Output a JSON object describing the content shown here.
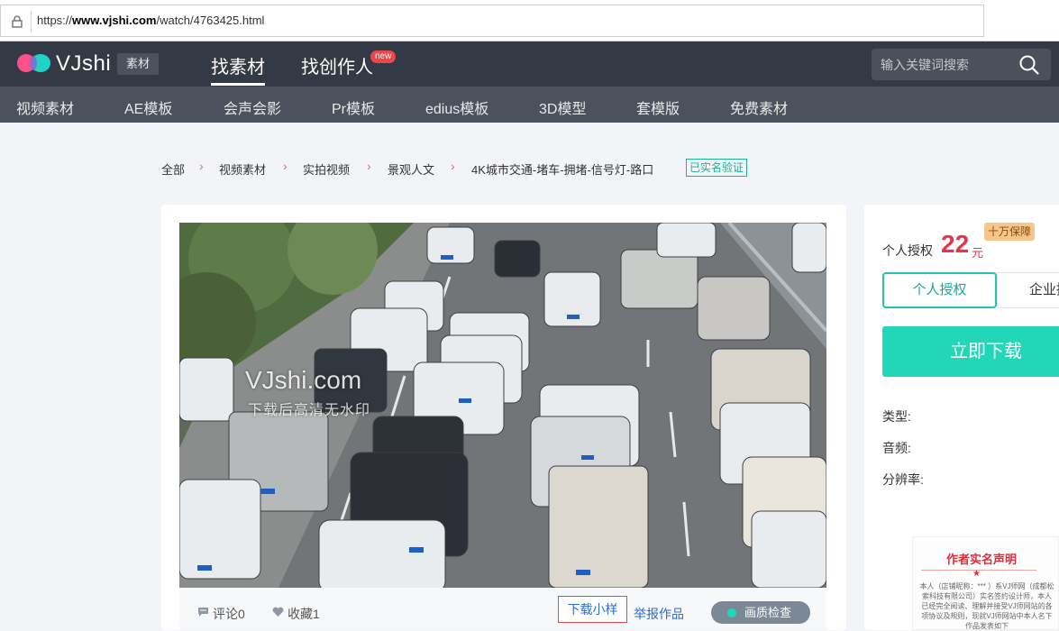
{
  "browser": {
    "url_prefix": "https://",
    "url_domain": "www.vjshi.com",
    "url_path": "/watch/4763425.html"
  },
  "header": {
    "logo_text": "VJshi",
    "logo_badge": "素材",
    "nav": [
      {
        "label": "找素材"
      },
      {
        "label": "找创作人",
        "badge": "new"
      }
    ],
    "search_placeholder": "输入关键词搜索"
  },
  "subnav": [
    {
      "label": "视频素材"
    },
    {
      "label": "AE模板"
    },
    {
      "label": "会声会影"
    },
    {
      "label": "Pr模板"
    },
    {
      "label": "edius模板"
    },
    {
      "label": "3D模型"
    },
    {
      "label": "套模版"
    },
    {
      "label": "免费素材"
    }
  ],
  "breadcrumb": [
    {
      "label": "全部"
    },
    {
      "label": "视频素材"
    },
    {
      "label": "实拍视频"
    },
    {
      "label": "景观人文"
    },
    {
      "label": "4K城市交通-堵车-拥堵-信号灯-路口"
    }
  ],
  "verified": "已实名验证",
  "video": {
    "watermark_title": "VJshi.com",
    "watermark_sub": "下载后高清无水印"
  },
  "footer": {
    "comments": "评论0",
    "favorites": "收藏1",
    "sample": "下载小样",
    "report": "举报作品",
    "quality": "画质检查"
  },
  "purchase": {
    "license_label": "个人授权",
    "price": "22",
    "unit": "元",
    "guarantee": "十万保障",
    "tab_personal": "个人授权",
    "tab_enterprise": "企业授",
    "download": "立即下载",
    "type_label": "类型:",
    "audio_label": "音频:",
    "resolution_label": "分辨率:"
  },
  "statement": {
    "title": "作者实名声明",
    "body": "本人（店铺昵称：*** ）系VJ师网（成都松索科技有限公司）实名签约设计师，本人已经完全阅读、理解并接受VJ师网站的各项协议及规则，现就VJ师网站中本人名下作品发表如下"
  },
  "colors": {
    "accent": "#21d7b8",
    "price": "#e8334a",
    "topnav": "#343a45",
    "subnav": "#4b525d"
  }
}
